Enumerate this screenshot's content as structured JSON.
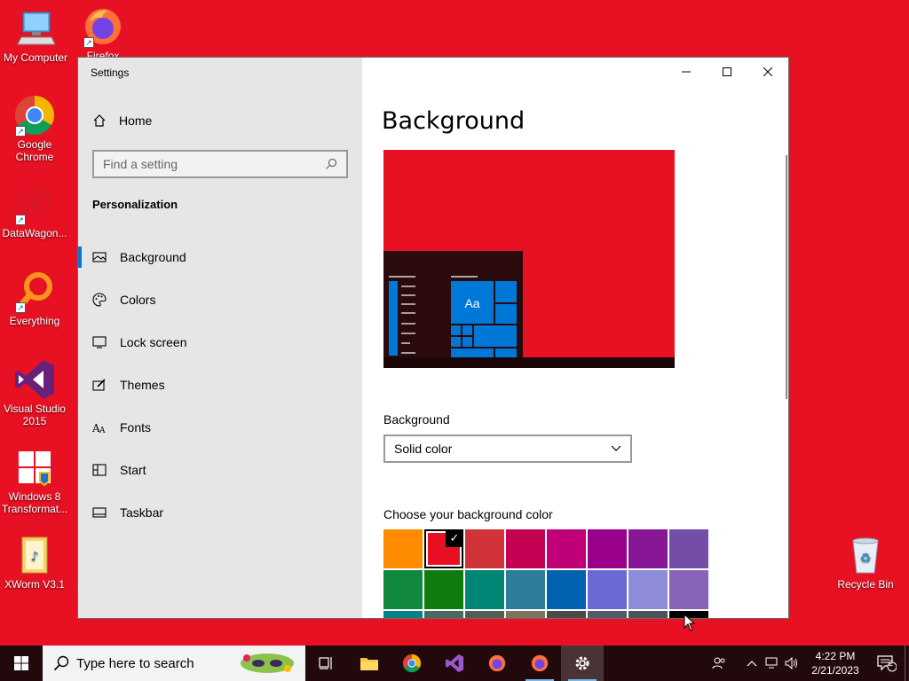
{
  "desktop": {
    "icons": [
      {
        "label": "My Computer"
      },
      {
        "label": "Firefox"
      },
      {
        "label": "Google Chrome"
      },
      {
        "label": "DataWagon..."
      },
      {
        "label": "Everything"
      },
      {
        "label": "Visual Studio 2015"
      },
      {
        "label": "Windows 8 Transformat..."
      },
      {
        "label": "XWorm V3.1"
      },
      {
        "label": "Recycle Bin"
      }
    ]
  },
  "window": {
    "title": "Settings",
    "home": "Home",
    "search_placeholder": "Find a setting",
    "section": "Personalization",
    "nav": [
      {
        "label": "Background",
        "icon": "image-icon"
      },
      {
        "label": "Colors",
        "icon": "palette-icon"
      },
      {
        "label": "Lock screen",
        "icon": "lock-screen-icon"
      },
      {
        "label": "Themes",
        "icon": "brush-icon"
      },
      {
        "label": "Fonts",
        "icon": "font-icon"
      },
      {
        "label": "Start",
        "icon": "start-icon"
      },
      {
        "label": "Taskbar",
        "icon": "taskbar-icon"
      }
    ],
    "active_nav": "Background"
  },
  "content": {
    "title": "Background",
    "preview_tile_text": "Aa",
    "background_label": "Background",
    "background_value": "Solid color",
    "color_label": "Choose your background color",
    "selected_color": "#e81123",
    "colors": [
      "#ff8c00",
      "#e81123",
      "#d13438",
      "#c30052",
      "#bf0077",
      "#9a0089",
      "#881798",
      "#744da9",
      "#10893e",
      "#107c10",
      "#018574",
      "#2d7d9a",
      "#0063b1",
      "#6b69d6",
      "#8e8cd8",
      "#8764b8",
      "#038387",
      "#486860",
      "#525e54",
      "#7e735f",
      "#4c4a48",
      "#515c6b",
      "#4a5459",
      "#000000"
    ]
  },
  "taskbar": {
    "search_placeholder": "Type here to search",
    "time": "4:22 PM",
    "date": "2/21/2023",
    "notification_count": "2"
  }
}
